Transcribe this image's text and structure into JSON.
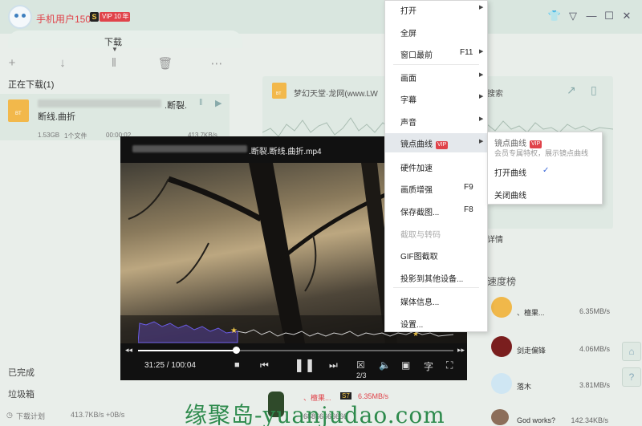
{
  "topbar": {
    "username": "手机用户150*",
    "badge_s": "S",
    "badge_vip": "VIP 10",
    "badge_year": "年",
    "active_tab": "下载"
  },
  "task": {
    "section": "正在下载(1)",
    "icon_tag": "BT",
    "name_line1": ".断裂.",
    "name_line2": "断线.曲折",
    "size": "1.53GB",
    "file_count": "1个文件",
    "elapsed": "00:00:02",
    "speed": "413.7KB/s"
  },
  "left_nav": {
    "done": "已完成",
    "trash": "垃圾箱"
  },
  "status": {
    "plan": "下载计划",
    "speeds": "413.7KB/s +0B/s"
  },
  "right_panel": {
    "site_title": "梦幻天堂·龙网(www.LW",
    "search": "搜索",
    "folder_tag": "BT",
    "detail": "详情",
    "rank_title": "速度榜",
    "ranks": [
      {
        "name": "、檀果...",
        "speed": "6.35MB/s"
      },
      {
        "name": "剑走偏锋",
        "speed": "4.06MB/s"
      },
      {
        "name": "落木",
        "speed": "3.81MB/s"
      },
      {
        "name": "God works?",
        "speed": "142.34KB/s"
      }
    ]
  },
  "bottom_user": {
    "name": "、檀果...",
    "badge": "S7",
    "speed": "6.35MB/s",
    "id": "68866666666"
  },
  "player": {
    "title": ".断裂.断线.曲折.mp4",
    "time": "31:25 / 100:04",
    "page": "2/3",
    "progress_fraction": 0.31
  },
  "menu": {
    "items": [
      {
        "label": "打开",
        "shortcut": "",
        "arrow": true
      },
      {
        "label": "全屏",
        "shortcut": "",
        "arrow": false
      },
      {
        "label": "窗口最前",
        "shortcut": "F11",
        "arrow": true
      },
      {
        "label": "画面",
        "shortcut": "",
        "arrow": true
      },
      {
        "label": "字幕",
        "shortcut": "",
        "arrow": true
      },
      {
        "label": "声音",
        "shortcut": "",
        "arrow": true
      },
      {
        "label": "镜点曲线",
        "shortcut": "",
        "arrow": true,
        "vip": "VIP"
      },
      {
        "label": "硬件加速",
        "shortcut": "",
        "arrow": false
      },
      {
        "label": "画质增强",
        "shortcut": "F9",
        "arrow": false
      },
      {
        "label": "保存截图...",
        "shortcut": "F8",
        "arrow": false
      },
      {
        "label": "截取与转码",
        "shortcut": "",
        "arrow": false
      },
      {
        "label": "GIF图截取",
        "shortcut": "",
        "arrow": false
      },
      {
        "label": "投影到其他设备...",
        "shortcut": "",
        "arrow": false
      },
      {
        "label": "媒体信息...",
        "shortcut": "",
        "arrow": false
      },
      {
        "label": "设置...",
        "shortcut": "",
        "arrow": false
      }
    ]
  },
  "submenu": {
    "title": "镜点曲线",
    "vip": "VIP",
    "desc": "会员专属特权，展示镜点曲线",
    "open": "打开曲线",
    "check": "✓",
    "close": "关闭曲线"
  },
  "watermark": "缘聚岛-yuanjudao.com",
  "colors": {
    "accent": "#e0434a",
    "menu_highlight": "#e4e8ec",
    "watermark": "#2d8a4c"
  }
}
